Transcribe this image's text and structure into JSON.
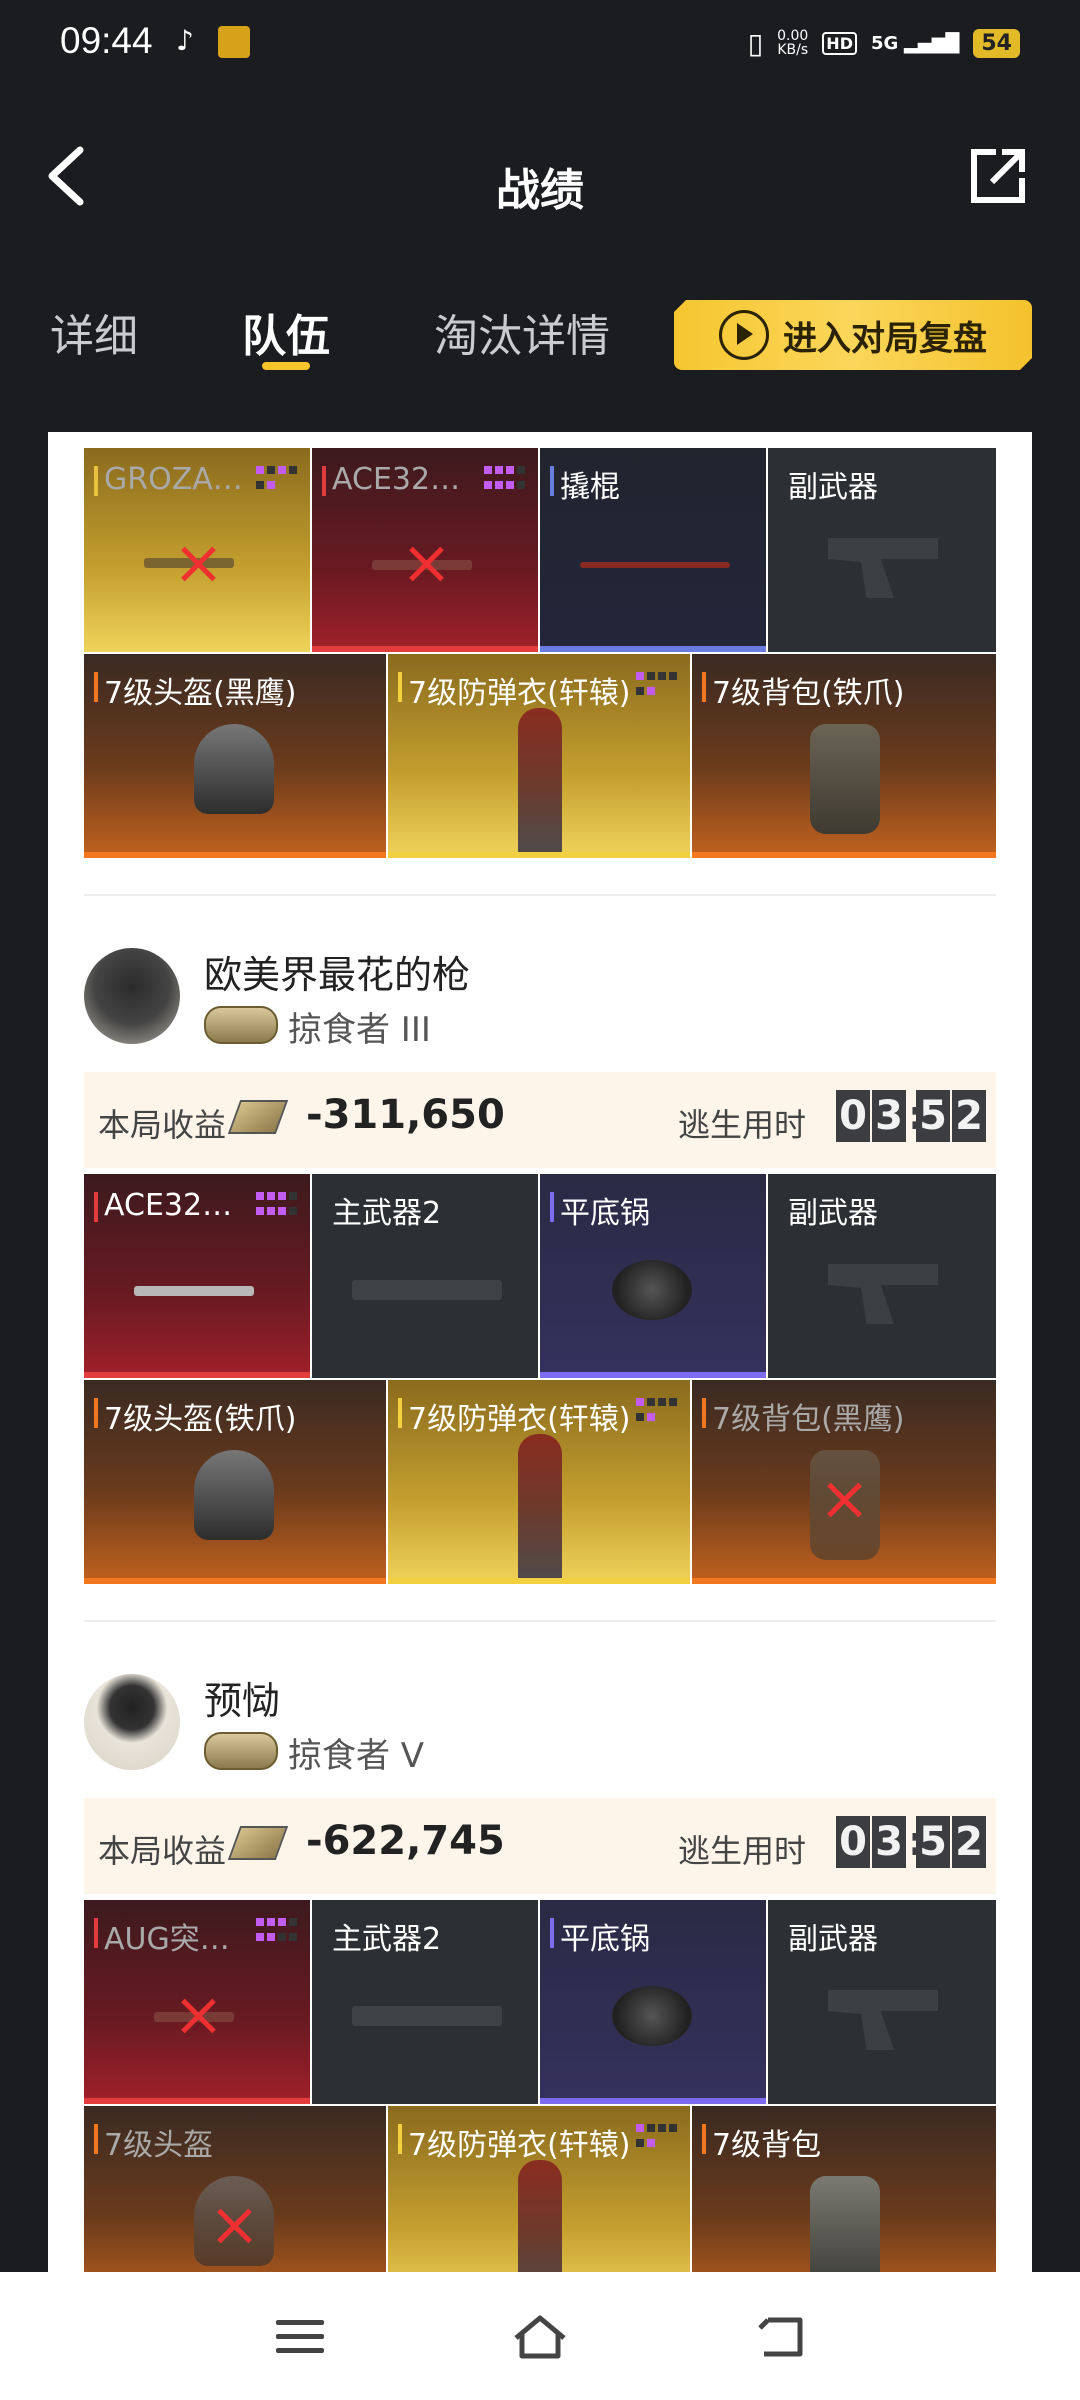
{
  "status": {
    "time": "09:44",
    "speed": "0.00",
    "speed_unit": "KB/s",
    "hd": "HD",
    "network": "5G",
    "battery": "54"
  },
  "header": {
    "title": "战绩"
  },
  "tabs": [
    {
      "label": "详细"
    },
    {
      "label": "队伍"
    },
    {
      "label": "淘汰详情"
    }
  ],
  "replay_button": {
    "label": "进入对局复盘"
  },
  "player0": {
    "weapons": [
      {
        "label": "GROZA…",
        "state": "lost"
      },
      {
        "label": "ACE32…",
        "state": "lost"
      },
      {
        "label": "撬棍",
        "state": "owned"
      },
      {
        "label": "副武器",
        "state": "empty"
      }
    ],
    "gear": [
      {
        "label": "7级头盔(黑鹰)"
      },
      {
        "label": "7级防弹衣(轩辕)"
      },
      {
        "label": "7级背包(铁爪)"
      }
    ]
  },
  "player1": {
    "name": "欧美界最花的枪",
    "rank": "掠食者 III",
    "earn_label": "本局收益",
    "earn_value": "-311,650",
    "time_label": "逃生用时",
    "time_digits": [
      "0",
      "3",
      "5",
      "2"
    ],
    "weapons": [
      {
        "label": "ACE32…"
      },
      {
        "label": "主武器2"
      },
      {
        "label": "平底锅"
      },
      {
        "label": "副武器"
      }
    ],
    "gear": [
      {
        "label": "7级头盔(铁爪)"
      },
      {
        "label": "7级防弹衣(轩辕)"
      },
      {
        "label": "7级背包(黑鹰)"
      }
    ]
  },
  "player2": {
    "name": "预恸",
    "rank": "掠食者 V",
    "earn_label": "本局收益",
    "earn_value": "-622,745",
    "time_label": "逃生用时",
    "time_digits": [
      "0",
      "3",
      "5",
      "2"
    ],
    "weapons": [
      {
        "label": "AUG突…"
      },
      {
        "label": "主武器2"
      },
      {
        "label": "平底锅"
      },
      {
        "label": "副武器"
      }
    ],
    "gear": [
      {
        "label": "7级头盔"
      },
      {
        "label": "7级防弹衣(轩辕)"
      },
      {
        "label": "7级背包"
      }
    ]
  },
  "icons": {
    "back": "back-arrow-icon",
    "share": "share-icon",
    "replay": "play-circle-icon"
  },
  "colors": {
    "accent": "#f7c52a",
    "background": "#1a1c20"
  }
}
